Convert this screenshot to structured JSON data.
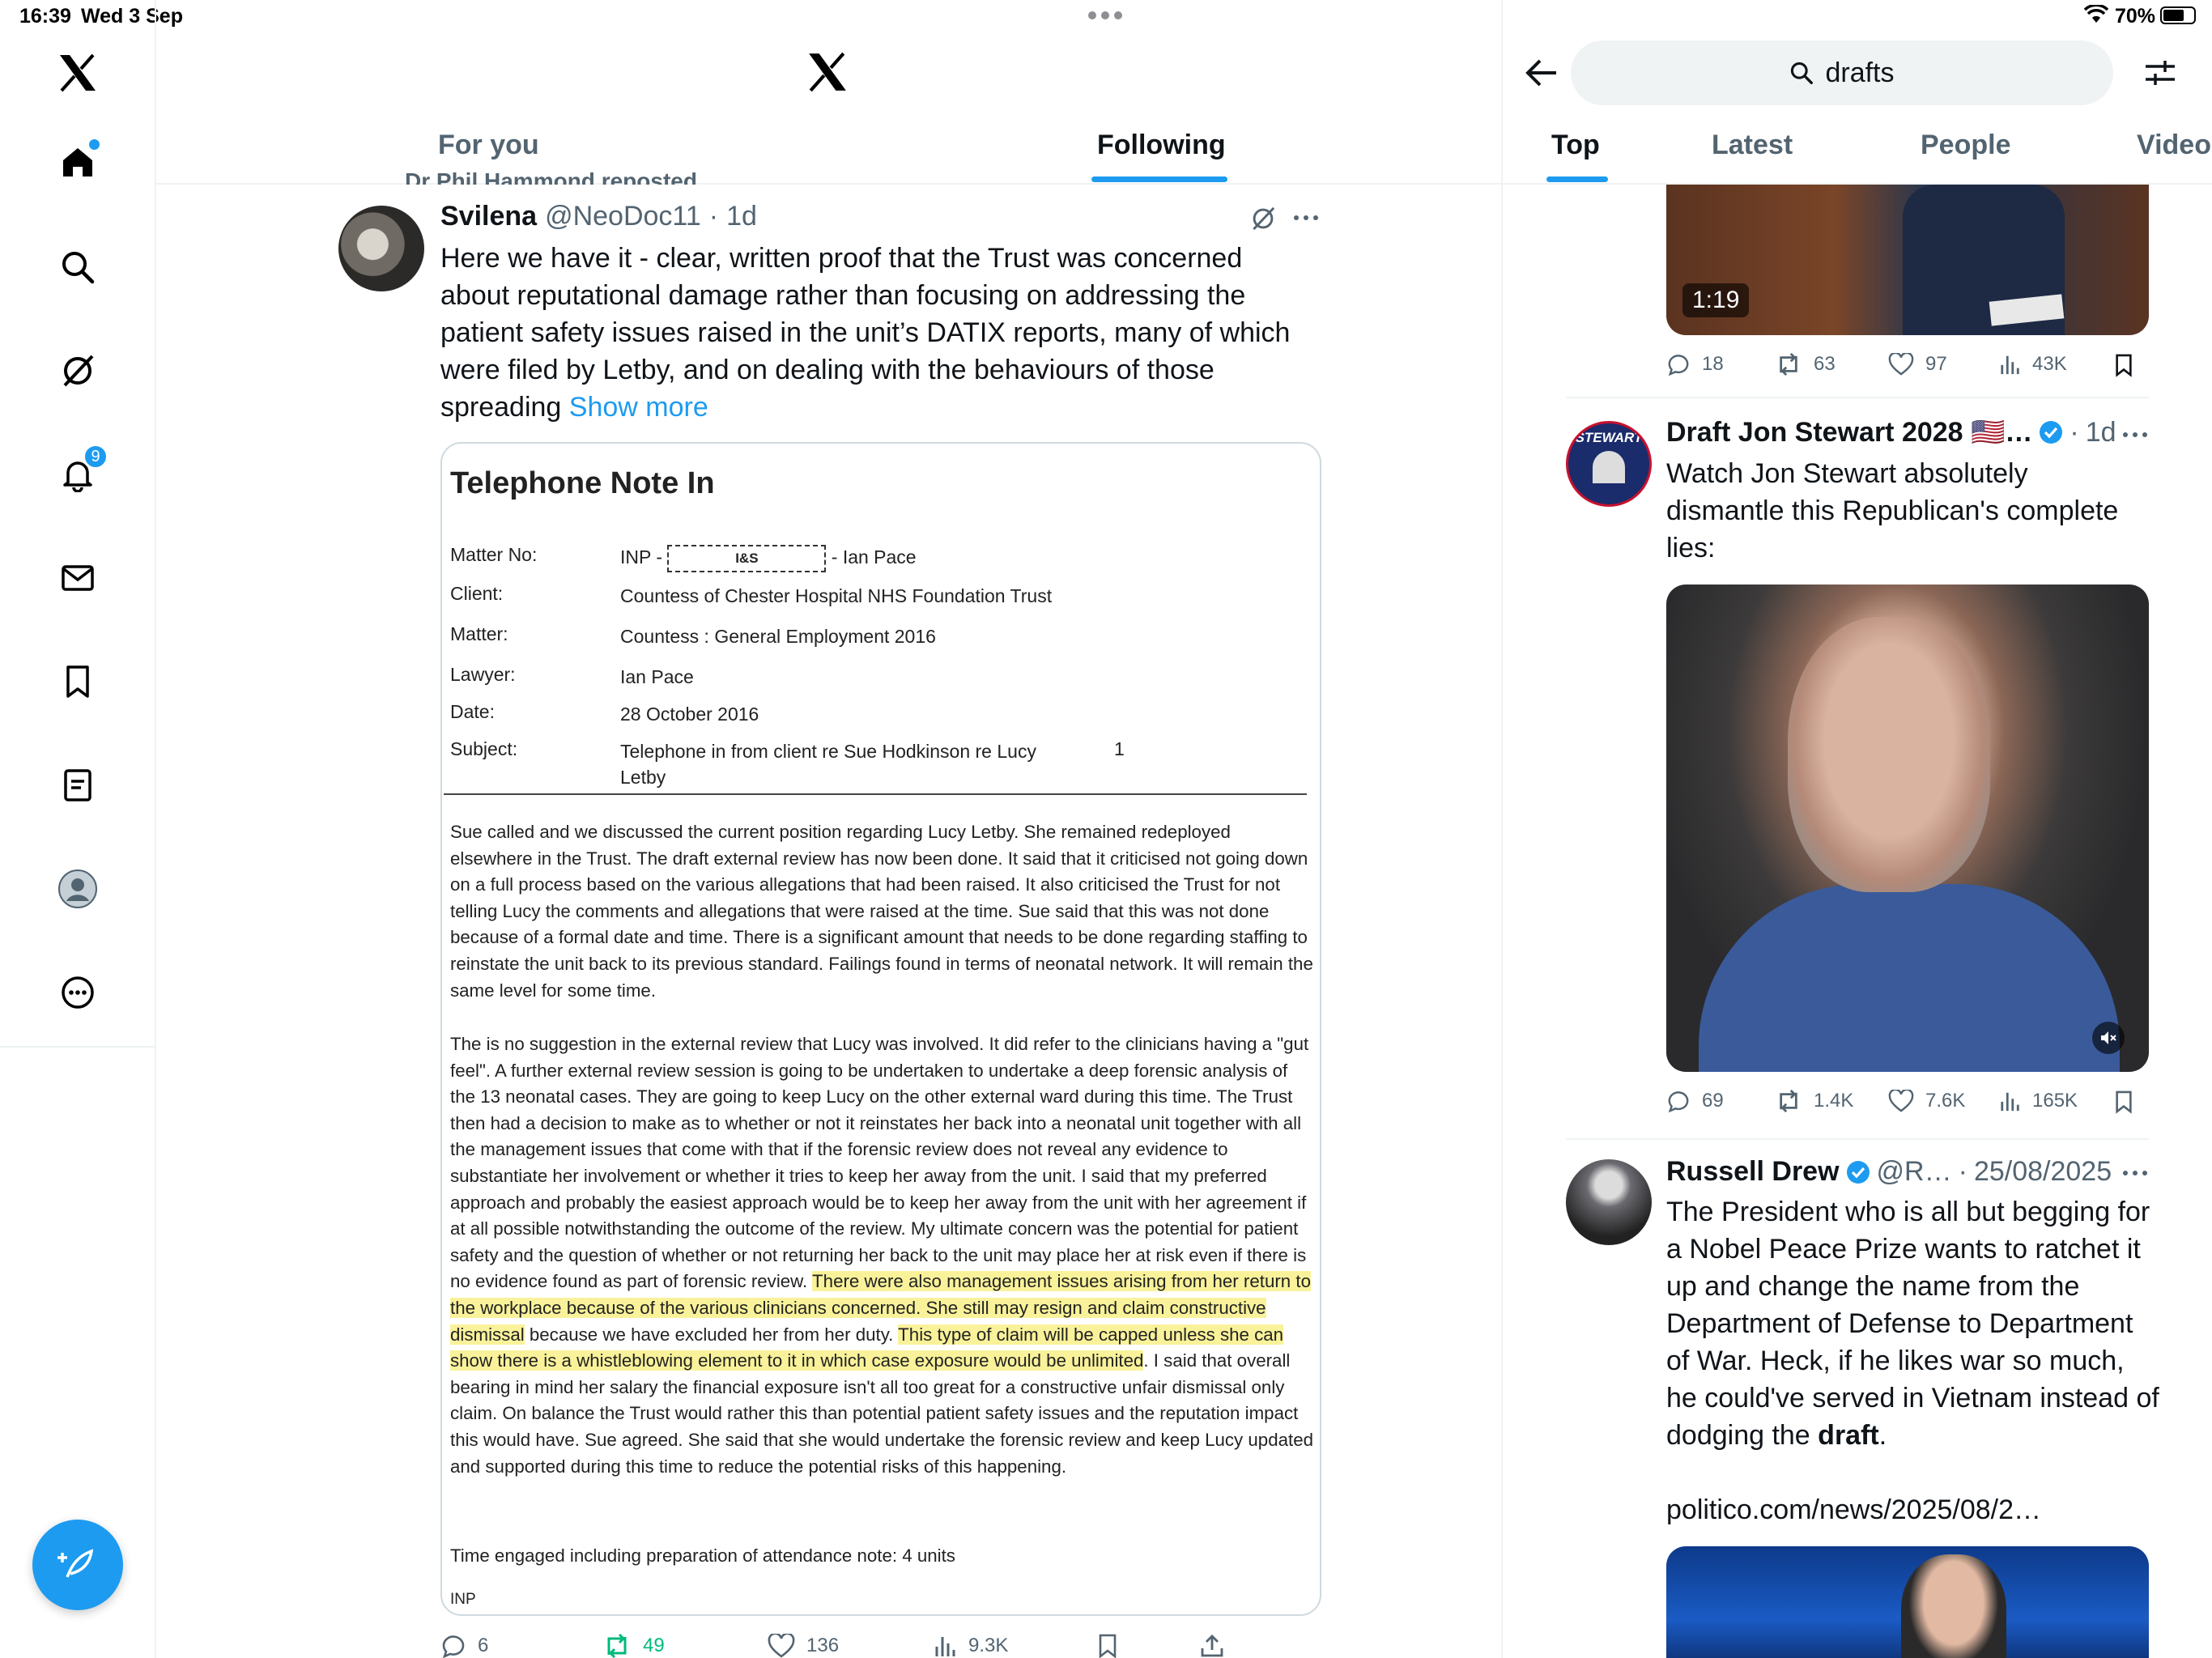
{
  "status_bar": {
    "time": "16:39",
    "date": "Wed 3 Sep",
    "battery": "70%"
  },
  "nav": {
    "notifications_badge": "9"
  },
  "main": {
    "tabs": [
      {
        "label": "For you"
      },
      {
        "label": "Following"
      }
    ],
    "repost_line": "Dr Phil Hammond reposted",
    "tweet": {
      "author": "Svilena",
      "handle": "@NeoDoc11",
      "time": "1d",
      "text": "Here we have it - clear, written proof that the Trust was concerned about reputational damage rather than focusing on addressing the patient safety issues raised in the unit’s DATIX reports, many of which were filed by Letby, and on dealing with the behaviours of those spreading",
      "show_more": "Show more",
      "doc": {
        "title": "Telephone Note In",
        "rows": [
          {
            "label": "Matter No:",
            "value": "INP - ",
            "box": "I&S",
            "suffix": " - Ian Pace"
          },
          {
            "label": "Client:",
            "value": "Countess of Chester Hospital NHS Foundation Trust"
          },
          {
            "label": "Matter:",
            "value": "Countess : General Employment 2016"
          },
          {
            "label": "Lawyer:",
            "value": "Ian Pace"
          },
          {
            "label": "Date:",
            "value": "28 October 2016"
          },
          {
            "label": "Subject:",
            "value": "Telephone in from client re Sue Hodkinson re Lucy Letby",
            "page": "1"
          }
        ],
        "para1": "Sue called and we discussed the current position regarding Lucy Letby.  She remained redeployed elsewhere in the Trust.  The draft external review has now been done.  It said that it criticised not going down on a full process based on the various allegations that had been raised.  It also criticised the Trust for not telling Lucy the comments and allegations that were raised at the time.  Sue said that this was not done because of a formal date and time.  There is a significant amount that needs to be done regarding staffing to reinstate the unit back to its previous standard.  Failings found in terms of neonatal network.  It will remain the same level for some time.",
        "para2_a": "The is no suggestion in the external review that Lucy was involved.  It did refer to the clinicians having a \"gut feel\".  A further external review session is going to be undertaken to undertake a deep forensic analysis of the 13 neonatal cases.  They are going to keep Lucy on the other external ward during this time.  The Trust then had a decision to make as to whether or not it reinstates her back into a neonatal unit together with all the management issues that come with that if the forensic review does not reveal any evidence to substantiate her involvement or whether it tries to keep her away from the unit.  I said that my preferred approach and probably the easiest approach would be to keep her away from the unit with her agreement if at all possible notwithstanding the outcome of the review.  My ultimate concern was the potential for patient safety and the question of whether or not returning her back to the unit may place her at risk even if there is no evidence found as part of forensic review.  ",
        "para2_hl1": "There were also management issues arising from her return to the workplace because of the various clinicians concerned.  She still may resign and claim constructive dismissal",
        "para2_b": " because we have excluded her from her duty.  ",
        "para2_hl2": "This type of claim will be capped unless she can show there is a whistleblowing element to it in which case exposure would be unlimited",
        "para2_c": ".  I said that overall bearing in mind her salary the financial exposure isn't all too great for a constructive unfair dismissal only claim.  On balance the Trust would rather this than potential patient safety issues and the reputation impact this would have.  Sue agreed.  She said that she would undertake the forensic review and keep Lucy updated and supported during this time to reduce the potential risks of this happening.",
        "time_engaged": "Time engaged including preparation of attendance note: 4 units",
        "initials": "INP"
      },
      "actions": {
        "replies": "6",
        "reposts": "49",
        "likes": "136",
        "views": "9.3K"
      }
    }
  },
  "right": {
    "search_value": "drafts",
    "tabs": [
      {
        "label": "Top"
      },
      {
        "label": "Latest"
      },
      {
        "label": "People"
      },
      {
        "label": "Video"
      }
    ],
    "video1": {
      "duration": "1:19",
      "replies": "18",
      "reposts": "63",
      "likes": "97",
      "views": "43K"
    },
    "post2": {
      "author": "Draft Jon Stewart 2028 🇺🇸…",
      "time": "1d",
      "avatar_text": "STEWART",
      "text": "Watch Jon Stewart absolutely dismantle this Republican's complete lies:",
      "replies": "69",
      "reposts": "1.4K",
      "likes": "7.6K",
      "views": "165K"
    },
    "post3": {
      "author": "Russell Drew",
      "handle": "@R…",
      "time": "25/08/2025",
      "text_before": "The President who is all but begging for a Nobel Peace Prize wants to ratchet it up and change the name from the Department of Defense to Department of War. Heck, if he likes war so much, he could've served in Vietnam instead of dodging the ",
      "text_bold": "draft",
      "text_after": ".",
      "link": "politico.com/news/2025/08/2…"
    }
  }
}
